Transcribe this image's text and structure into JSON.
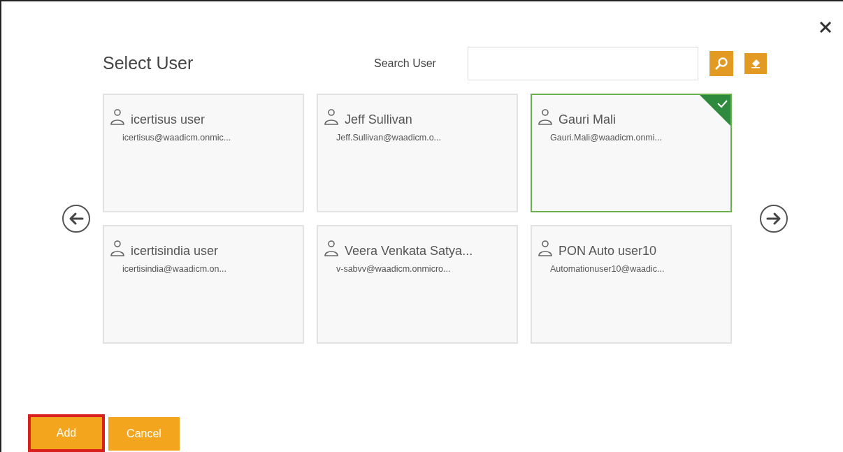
{
  "dialog": {
    "title": "Select User",
    "search": {
      "label": "Search User"
    }
  },
  "users": [
    {
      "name": "icertisus user",
      "email": "icertisus@waadicm.onmic...",
      "selected": false
    },
    {
      "name": "Jeff Sullivan",
      "email": "Jeff.Sullivan@waadicm.o...",
      "selected": false
    },
    {
      "name": "Gauri Mali",
      "email": "Gauri.Mali@waadicm.onmi...",
      "selected": true
    },
    {
      "name": "icertisindia user",
      "email": "icertisindia@waadicm.on...",
      "selected": false
    },
    {
      "name": "Veera Venkata Satya...",
      "email": "v-sabvv@waadicm.onmicro...",
      "selected": false
    },
    {
      "name": "PON Auto user10",
      "email": "Automationuser10@waadic...",
      "selected": false
    }
  ],
  "buttons": [
    {
      "label": "Add",
      "highlighted": true
    },
    {
      "label": "Cancel",
      "highlighted": false
    }
  ]
}
